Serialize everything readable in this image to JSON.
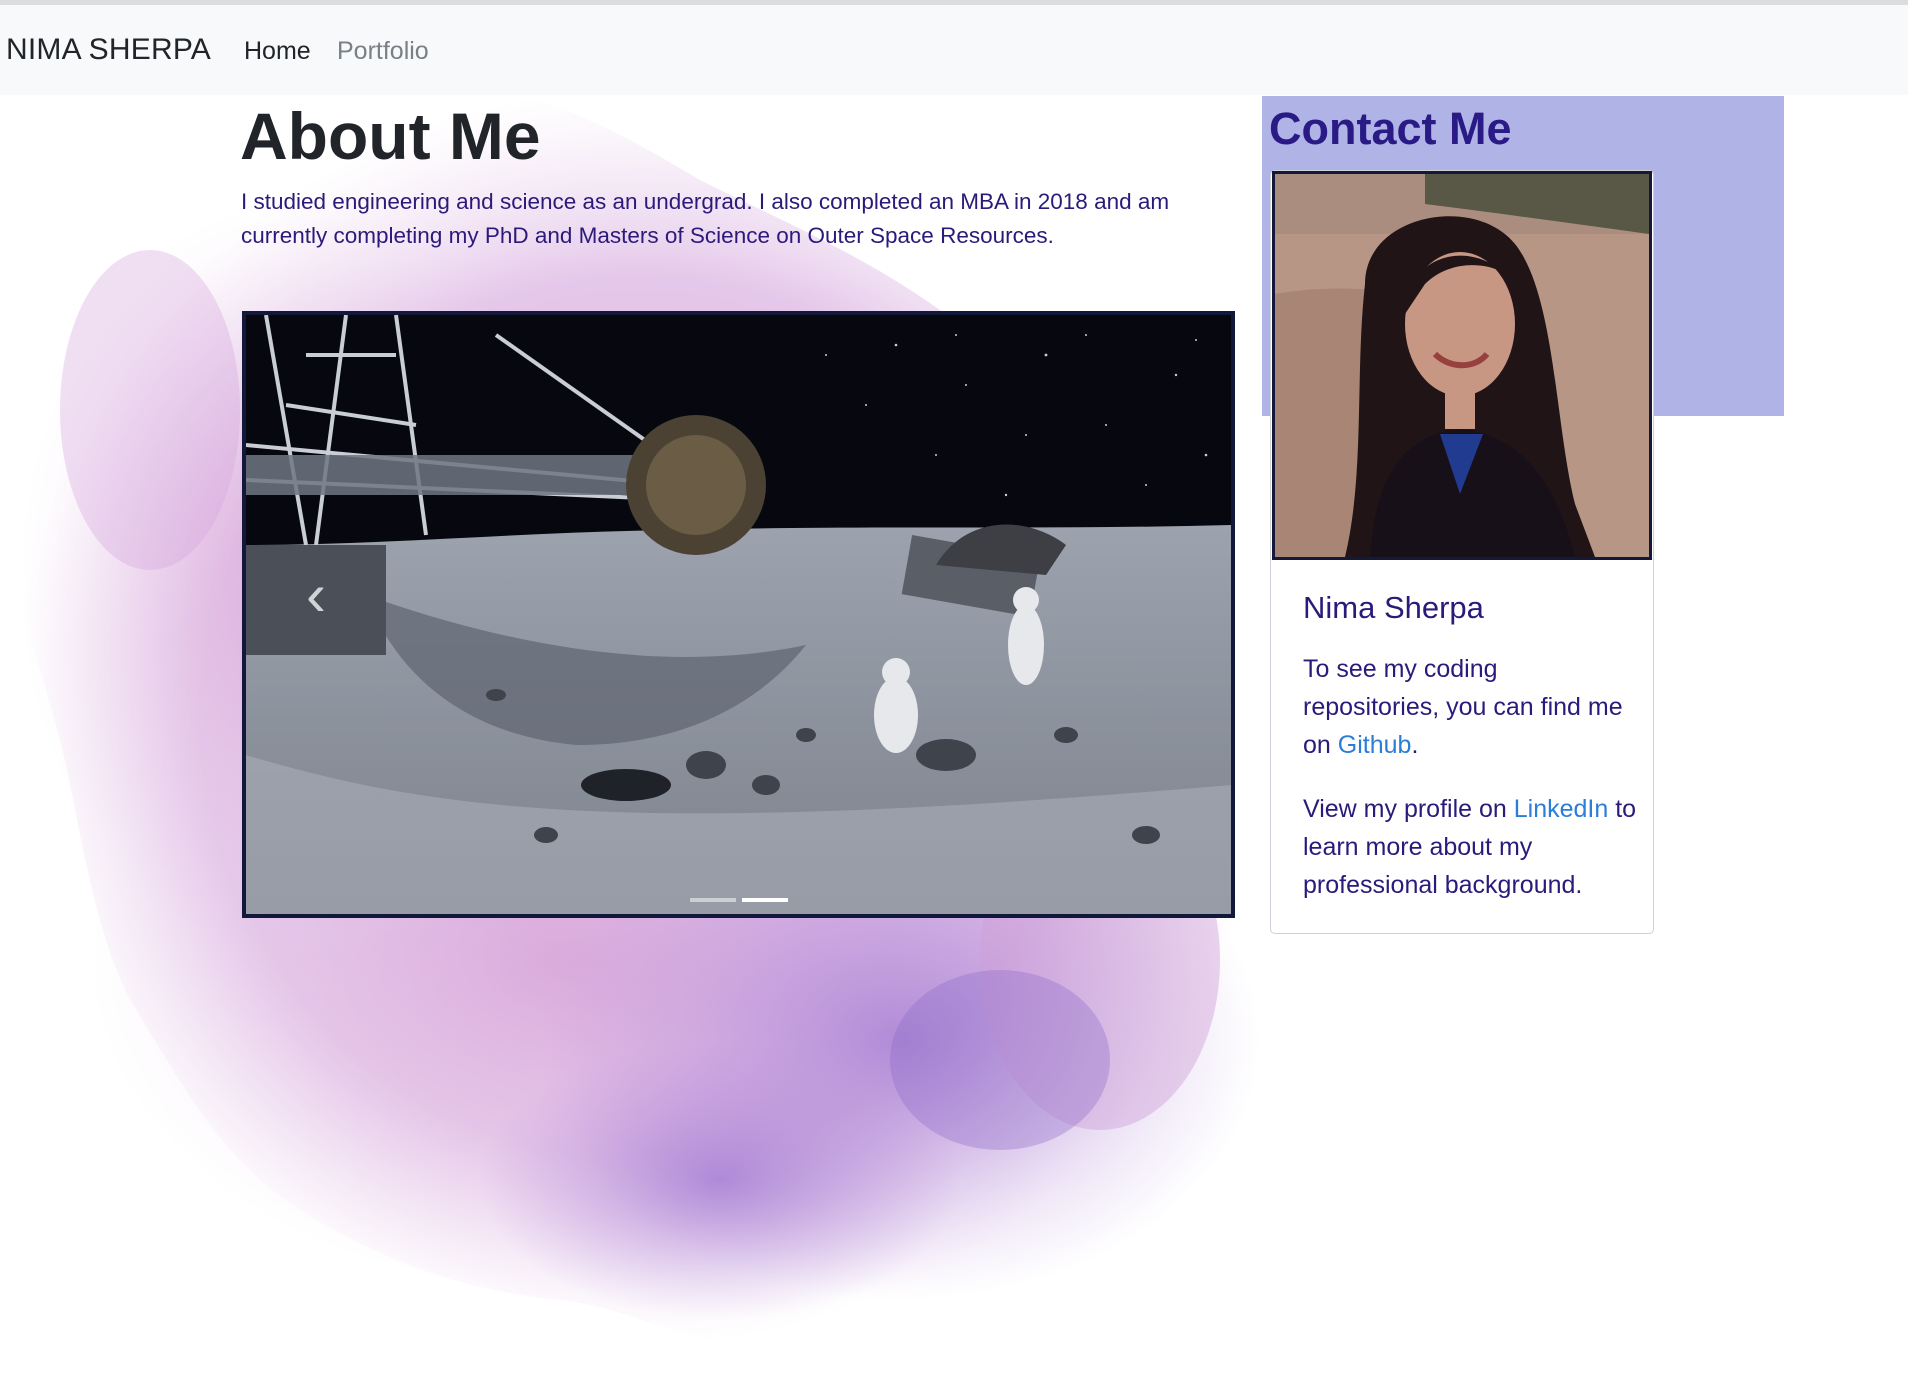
{
  "navbar": {
    "brand": "NIMA SHERPA",
    "links": [
      "Home",
      "Portfolio"
    ]
  },
  "about": {
    "title": "About Me",
    "text": "I studied engineering and science as an undergrad. I also completed an MBA in 2018 and am currently completing my PhD and Masters of Science on Outer Space Resources."
  },
  "carousel": {
    "prev_icon": "chevron-left-icon",
    "slides": 2,
    "active_slide": 2
  },
  "contact": {
    "title": "Contact Me",
    "name": "Nima Sherpa",
    "line1_prefix": "To see my coding repositories, you can find me on ",
    "github_label": "Github",
    "line1_suffix": ".",
    "line2_prefix": "View my profile on ",
    "linkedin_label": "LinkedIn",
    "line2_suffix": " to learn more about my professional background."
  },
  "colors": {
    "navbar_bg": "#f8f9fa",
    "contact_panel_bg": "#afb3e6",
    "heading_purple": "#2a1a86",
    "body_text": "#2b1a7a",
    "link": "#2b7ed8",
    "splash": "#b47ac8"
  }
}
